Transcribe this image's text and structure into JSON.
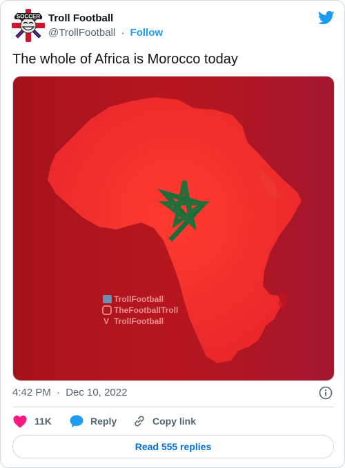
{
  "author": {
    "name": "Troll Football",
    "handle": "@TrollFootball",
    "separator": "·",
    "follow_label": "Follow",
    "avatar_lettering": "SOCCER"
  },
  "tweet": {
    "text": "The whole of Africa is Morocco today",
    "time": "4:42 PM",
    "date": "Dec 10, 2022",
    "meta_separator": "·"
  },
  "media": {
    "watermarks": [
      "TrollFootball",
      "TheFootballTroll",
      "TrollFootball"
    ],
    "icons": [
      "twitter-icon",
      "instagram-icon",
      "vine-icon"
    ]
  },
  "actions": {
    "like_count": "11K",
    "reply_label": "Reply",
    "copy_label": "Copy link"
  },
  "footer": {
    "read_replies_label": "Read 555 replies"
  },
  "colors": {
    "brand_blue": "#1d9bf0",
    "like_pink": "#f91880",
    "text_primary": "#0f1419",
    "text_secondary": "#536471",
    "border": "#cfd9de",
    "flag_red": "#c1272d",
    "flag_green": "#006233"
  }
}
